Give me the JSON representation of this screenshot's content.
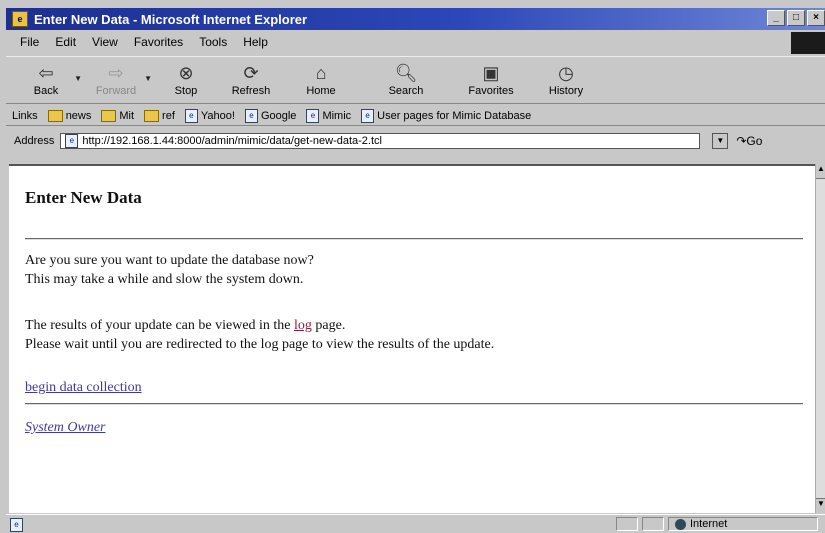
{
  "window": {
    "title": "Enter New Data - Microsoft Internet Explorer",
    "buttons": [
      "_",
      "□",
      "×"
    ]
  },
  "menu": [
    "File",
    "Edit",
    "View",
    "Favorites",
    "Tools",
    "Help"
  ],
  "toolbar": {
    "back": "Back",
    "forward": "Forward",
    "stop": "Stop",
    "refresh": "Refresh",
    "home": "Home",
    "search": "Search",
    "favorites": "Favorites",
    "history": "History"
  },
  "links": {
    "label": "Links",
    "items": [
      "news",
      "Mit",
      "ref",
      "Yahoo!",
      "Google",
      "Mimic",
      "User pages for Mimic Database"
    ]
  },
  "address": {
    "label": "Address",
    "url": "http://192.168.1.44:8000/admin/mimic/data/get-new-data-2.tcl",
    "go": "Go"
  },
  "page": {
    "heading": "Enter New Data",
    "line1": "Are you sure you want to update the database now?",
    "line2": "This may take a while and slow the system down.",
    "line3_pre": "The results of your update can be viewed in the ",
    "line3_link": "log",
    "line3_post": " page.",
    "line4": "Please wait until you are redirected to the log page to view the results of the update.",
    "begin_link": "begin data collection",
    "owner_link": "System Owner"
  },
  "status": {
    "zone": "Internet"
  }
}
